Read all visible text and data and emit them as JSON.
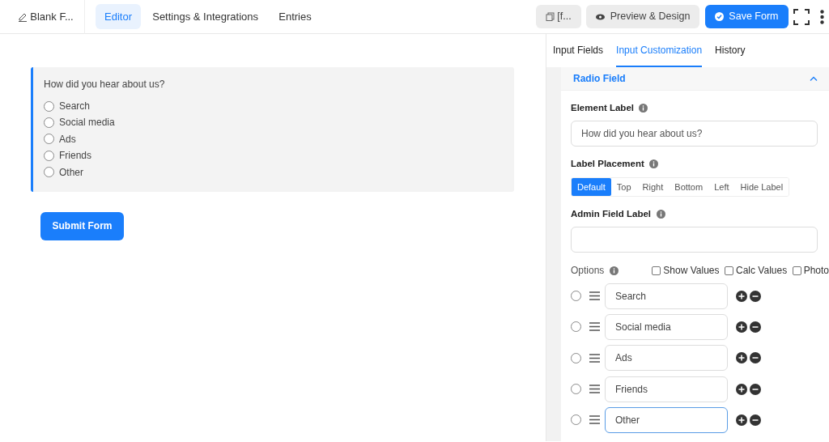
{
  "header": {
    "title": "Blank F...",
    "tabs": [
      {
        "label": "Editor",
        "selected": true
      },
      {
        "label": "Settings & Integrations",
        "selected": false
      },
      {
        "label": "Entries",
        "selected": false
      }
    ],
    "shortcode_button": "[f...",
    "preview_button": "Preview & Design",
    "save_button": "Save Form"
  },
  "form_preview": {
    "question": "How did you hear about us?",
    "options": [
      {
        "label": "Search",
        "checked": false
      },
      {
        "label": "Social media",
        "checked": false
      },
      {
        "label": "Ads",
        "checked": false
      },
      {
        "label": "Friends",
        "checked": false
      },
      {
        "label": "Other",
        "checked": false
      }
    ],
    "submit_button": "Submit Form"
  },
  "panel": {
    "tabs": [
      {
        "label": "Input Fields",
        "selected": false
      },
      {
        "label": "Input Customization",
        "selected": true
      },
      {
        "label": "History",
        "selected": false
      }
    ],
    "section": {
      "title": "Radio Field",
      "expanded": true
    },
    "element_label": {
      "label": "Element Label",
      "value": "How did you hear about us?"
    },
    "label_placement": {
      "label": "Label Placement",
      "options": [
        {
          "label": "Default",
          "selected": true
        },
        {
          "label": "Top",
          "selected": false
        },
        {
          "label": "Right",
          "selected": false
        },
        {
          "label": "Bottom",
          "selected": false
        },
        {
          "label": "Left",
          "selected": false
        },
        {
          "label": "Hide Label",
          "selected": false
        }
      ]
    },
    "admin_field_label": {
      "label": "Admin Field Label"
    },
    "options_label": "Options",
    "option_flags": [
      {
        "label": "Show Values",
        "checked": false
      },
      {
        "label": "Calc Values",
        "checked": false
      },
      {
        "label": "Photo",
        "checked": false
      }
    ],
    "choices": [
      {
        "value": "Search",
        "selected": false,
        "focused": false
      },
      {
        "value": "Social media",
        "selected": false,
        "focused": false
      },
      {
        "value": "Ads",
        "selected": false,
        "focused": false
      },
      {
        "value": "Friends",
        "selected": false,
        "focused": false
      },
      {
        "value": "Other",
        "selected": false,
        "focused": true
      }
    ]
  }
}
